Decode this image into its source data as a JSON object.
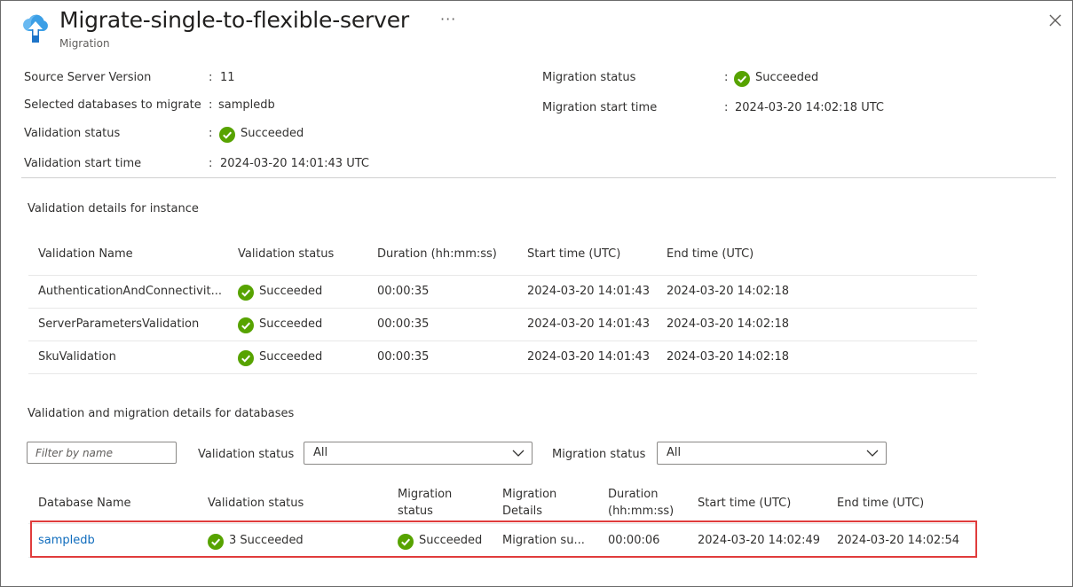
{
  "header": {
    "title": "Migrate-single-to-flexible-server",
    "subtitle": "Migration",
    "more_label": "···",
    "icons": {
      "logo": "cloud-upload-icon",
      "more": "ellipsis-icon",
      "close": "close-icon"
    }
  },
  "summary": {
    "colon": ":",
    "source_version_label": "Source Server Version",
    "source_version_value": "11",
    "selected_dbs_label": "Selected databases to migrate",
    "selected_dbs_value": "sampledb",
    "validation_status_label": "Validation status",
    "validation_status_value": "Succeeded",
    "validation_start_label": "Validation start time",
    "validation_start_value": "2024-03-20 14:01:43 UTC",
    "migration_status_label": "Migration status",
    "migration_status_value": "Succeeded",
    "migration_start_label": "Migration start time",
    "migration_start_value": "2024-03-20 14:02:18 UTC"
  },
  "instance_section": {
    "title": "Validation details for instance",
    "columns": [
      "Validation Name",
      "Validation status",
      "Duration (hh:mm:ss)",
      "Start time (UTC)",
      "End time (UTC)"
    ],
    "rows": [
      {
        "name": "AuthenticationAndConnectivit...",
        "status": "Succeeded",
        "duration": "00:00:35",
        "start": "2024-03-20 14:01:43",
        "end": "2024-03-20 14:02:18"
      },
      {
        "name": "ServerParametersValidation",
        "status": "Succeeded",
        "duration": "00:00:35",
        "start": "2024-03-20 14:01:43",
        "end": "2024-03-20 14:02:18"
      },
      {
        "name": "SkuValidation",
        "status": "Succeeded",
        "duration": "00:00:35",
        "start": "2024-03-20 14:01:43",
        "end": "2024-03-20 14:02:18"
      }
    ]
  },
  "db_section": {
    "title": "Validation and migration details for databases",
    "filter_placeholder": "Filter by name",
    "validation_filter_label": "Validation status",
    "validation_filter_value": "All",
    "migration_filter_label": "Migration status",
    "migration_filter_value": "All",
    "columns": {
      "db_name": "Database Name",
      "validation_status": "Validation status",
      "migration_status_1": "Migration",
      "migration_status_2": "status",
      "migration_details_1": "Migration",
      "migration_details_2": "Details",
      "duration_1": "Duration",
      "duration_2": "(hh:mm:ss)",
      "start": "Start time (UTC)",
      "end": "End time (UTC)"
    },
    "rows": [
      {
        "name": "sampledb",
        "validation": "3 Succeeded",
        "migration": "Succeeded",
        "details": "Migration su...",
        "duration": "00:00:06",
        "start": "2024-03-20 14:02:49",
        "end": "2024-03-20 14:02:54"
      }
    ]
  },
  "colors": {
    "success": "#57a300",
    "link": "#0f6cbd",
    "highlight": "#e03c3c"
  }
}
